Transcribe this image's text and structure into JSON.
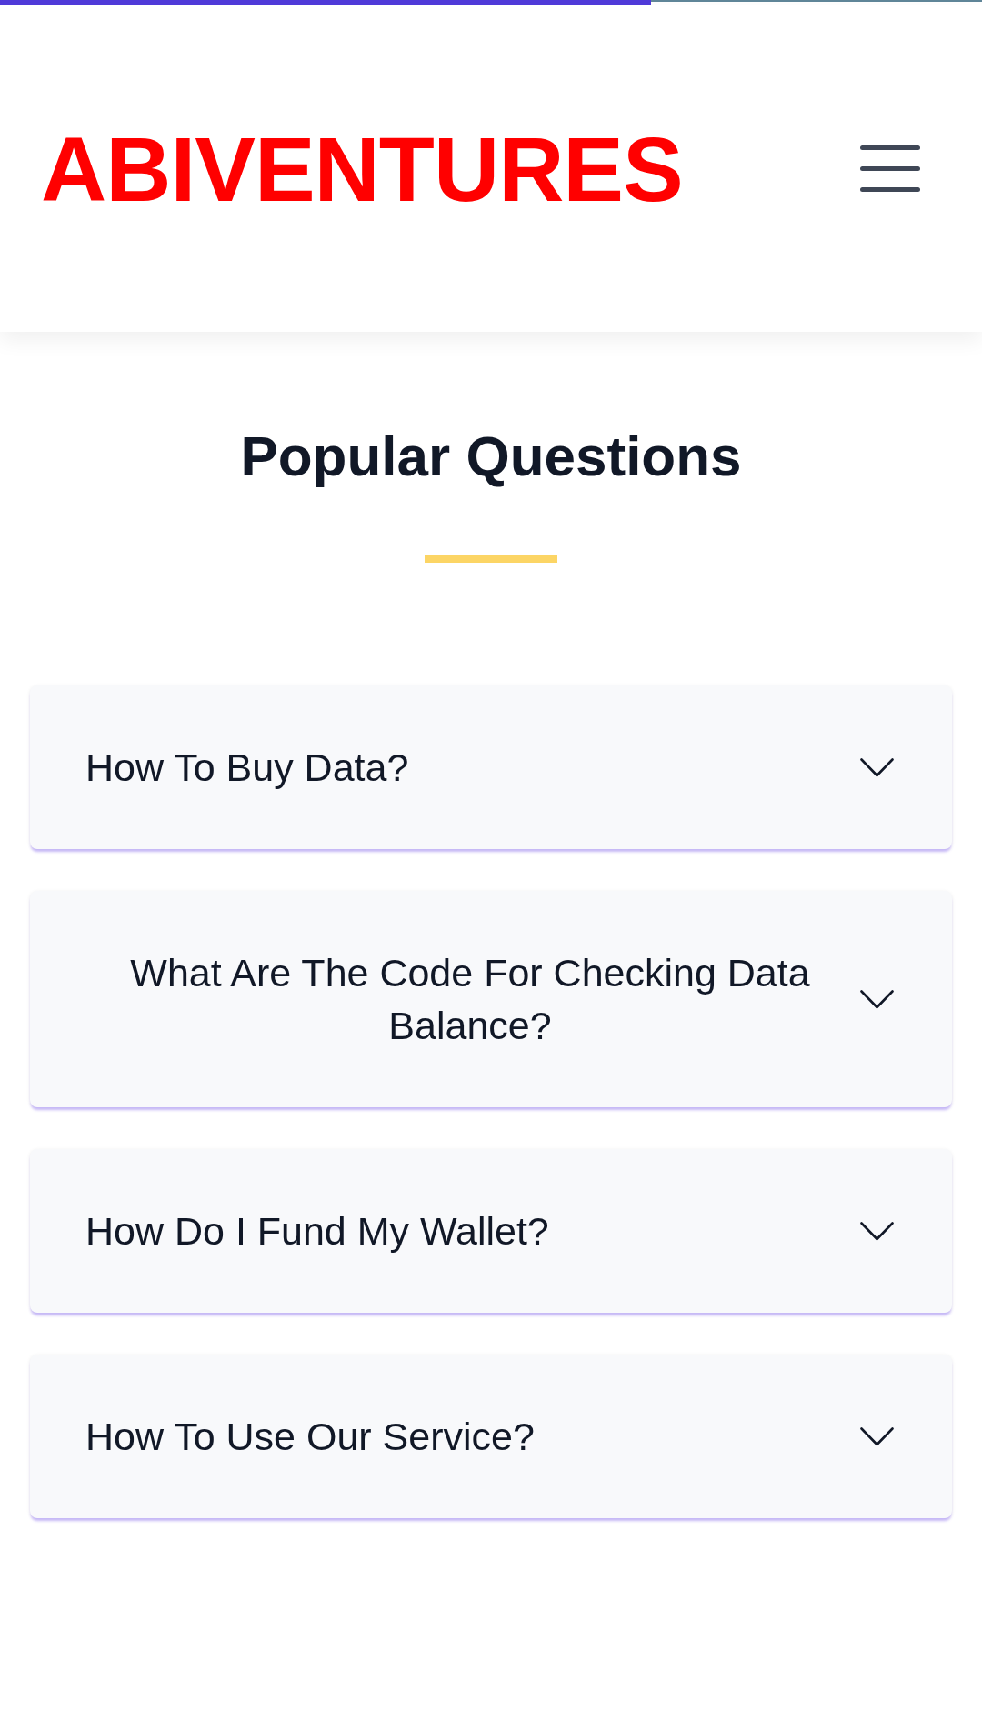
{
  "progress": {
    "level": 0.663
  },
  "header": {
    "logo": "ABIVENTURES"
  },
  "section": {
    "title": "Popular Questions"
  },
  "faq": [
    {
      "question": "How To Buy Data?",
      "expanded": false
    },
    {
      "question": "What Are The Code For Checking Data Balance?",
      "expanded": false
    },
    {
      "question": "How Do I Fund My Wallet?",
      "expanded": false
    },
    {
      "question": "How To Use Our Service?",
      "expanded": false
    }
  ]
}
